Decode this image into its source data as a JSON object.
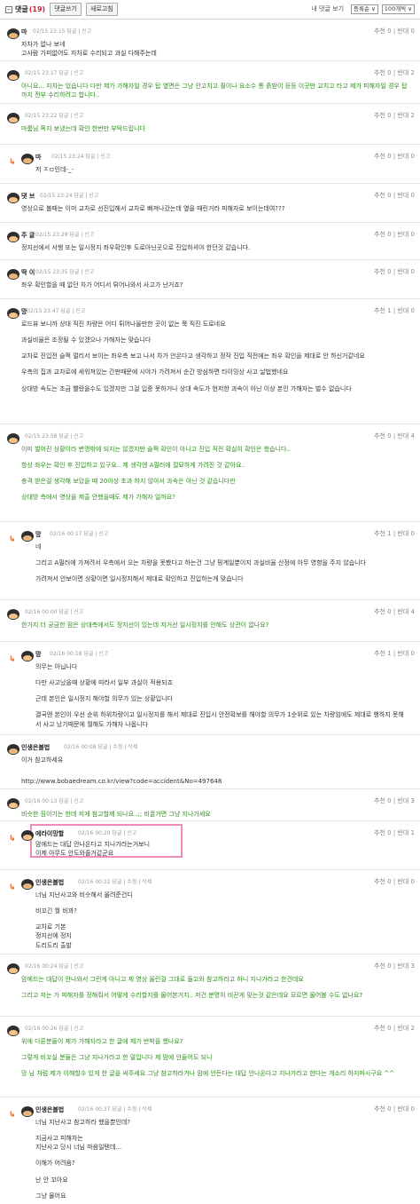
{
  "header": {
    "collapse_glyph": "−",
    "title": "댓글",
    "count": "(19)",
    "write_button": "댓글쓰기",
    "refresh_button": "새로고침",
    "my_comments": "내 댓글 보기",
    "sort_select": "등록순 ∨",
    "per_page_select": "100개씩 ∨"
  },
  "comments": [
    {
      "nick": "마",
      "meta": "02/15 23:15 답글 | 신고",
      "votes": "추천 0 | 반대 0",
      "color": "dark",
      "lines": [
        "자차가 없나 보네",
        "고사람 가피없어도 자차로 수리되고 과실 다해주는데"
      ]
    },
    {
      "nick": "",
      "meta": "02/15 23:17 답글 | 신고",
      "votes": "추천 0 | 반대 2",
      "color": "green",
      "lines": [
        "아니요... 자차는 있습니다 다만 제가 가해자일 경우 탑 옆면은 그냥 안고치고 휠이나 요소수 통 흙받이 등등 이곳만 교치고 타고 제가 피해자일 경우 탑까지 전부 수리하려고 합니다.."
      ]
    },
    {
      "nick": "",
      "meta": "02/15 23:22 답글 | 신고",
      "votes": "추천 0 | 반대 2",
      "color": "green",
      "lines": [
        "마룸님 쪽지 보냈는데 확인 한번만 부탁드립니다"
      ]
    },
    {
      "nick": "마",
      "meta": "02/15 23:24 답글 | 신고",
      "votes": "추천 0 | 반대 0",
      "color": "dark",
      "reply": true,
      "lines": [
        "저 ㅈㅁ인데-_-"
      ]
    },
    {
      "nick": "댓 브",
      "meta": "02/15 23:24 답글 | 신고",
      "votes": "추천 0 | 반대 0",
      "color": "dark",
      "lines": [
        "영상으로 볼때는 이미 교차로 선진입해서 교차로 빠져나갔는데 옆을 때린거라 피해자로 보이는데여???"
      ]
    },
    {
      "nick": "주     글",
      "meta": "02/15 23:29 답글 | 신고",
      "votes": "추천 0 | 반대 0",
      "color": "dark",
      "lines": [
        "정지선에서 서행 또는 일시정지 좌우확인후 도로아닌곳으로 진입하셔야 한던것 같습니다."
      ]
    },
    {
      "nick": "딱     이",
      "meta": "02/15 23:35 답글 | 신고",
      "votes": "추천 0 | 반대 0",
      "color": "dark",
      "lines": [
        "좌우 확인할을 때 없던 차가 어디서 튀어나와서 사고가 난거죠?"
      ]
    },
    {
      "nick": "망",
      "meta": "02/15 23:47 답글 | 신고",
      "votes": "추천 1 | 반대 0",
      "color": "dark",
      "lines": [
        "로드뷰 보니까 상대 직진 차량은 어디 튀어나올만한 곳이 없는 쭉 직진 도로네요",
        "과실비율은 조정될 수 있겠으나 가해자는 맞습니다",
        "교차로 진입전 슬쩍 멀리서 보이는 좌우측 보고 나서 차가 안온다고 생각하고 정작 진입 직전에는 좌우 확인을 제대로 안 하신거같네요",
        "우측의 집과 교차로에 세워져있는 간판때문에 시야가 가려져서 순간 방심하면 타이밍상 사고 날법했네요",
        "상대방 속도는 조금 빨랐을수도 있겠지만 그걸 입증 못하거나 상대 속도가 현저한 과속이 아닌 이상 본인 가해자는 벌수 없습니다"
      ]
    },
    {
      "nick": "",
      "meta": "02/15 23:58 답글 | 신고",
      "votes": "추천 0 | 반대 4",
      "color": "green",
      "lines": [
        "이미 벌어진 상황이라 변명밖에 되지는 않겠지만 슬쩍 확인이 아니고 진입 직전 확실히 확인은 했습니다..",
        "항상 좌우는 확인 후 진입하고 있구요.. 제 생각엔 A필러에 절묘하게 가려진 것 같아요..",
        "충격 받은걸 생각해 보았을 때 20이상 초과 하지 않아서 과속은 아닌 것 같습니다만",
        "상대방 측에서 영상을 제출 안했을때도 제가 가해자 일까요?"
      ]
    },
    {
      "nick": "망",
      "meta": "02/16 00:17 답글 | 신고",
      "votes": "추천 1 | 반대 0",
      "color": "dark",
      "reply": true,
      "lines": [
        "네",
        "그리고 A필러에 가져려서 우측에서 오는 차량을 못봤다고 하는건 그냥 핑계일뿐이지 과실비율 산정에 아무 영향을 주지 않습니다",
        "가려져서 안보이면 상황이면 일시정지해서 제대로 확인하고 진입하는게 맞습니다"
      ]
    },
    {
      "nick": "",
      "meta": "02/16 00:00 답글 | 신고",
      "votes": "추천 0 | 반대 4",
      "color": "green",
      "lines": [
        "한가지 더 궁금한 점은 상대측에서도 정지선이 있는데 저거선 일시정지를 안해도 상관이 없나요?"
      ]
    },
    {
      "nick": "망",
      "meta": "02/16 00:18 답글 | 신고",
      "votes": "추천 1 | 반대 0",
      "color": "dark",
      "reply": true,
      "lines": [
        "의무는 아닙니다",
        "다만 사고났을때 상황에 따라서 일부 과실이 적용되죠",
        "근데 본인은 일시정지 해야할 의무가 있는 상황입니다",
        "결국엔 본인이 우선 순위 하위차량이고 일시정지를 해서 제대로 진입시 안전확보를 해야할 의무가 1순위로 있는 차량임에도 제대로 행하지 못해서 사고 났기때문에 월해도 가해자 나옵니다"
      ]
    },
    {
      "nick": "인생은볼법",
      "meta": "02/16 00:08 답글 | 수정 | 삭제",
      "votes": "",
      "color": "dark",
      "lines": [
        "이거 참고하세유",
        "http://www.bobaedream.co.kr/view?code=accident&No=497648"
      ]
    },
    {
      "nick": "",
      "meta": "02/16 00:13 답글 | 신고",
      "votes": "추천 0 | 반대 3",
      "color": "green",
      "lines": [
        "비슷한 짐이기는 한데 저게 참고할께 되나요..;; 비끌거면 그냥 지나가세요"
      ]
    },
    {
      "nick": "에라이망할",
      "meta": "02/16 00:20 답글 | 신고",
      "votes": "추천 0 | 반대 1",
      "color": "dark",
      "reply": true,
      "highlight": true,
      "lines": [
        "맘에드는 대답 안나온다고 지나가라는거보니",
        "이제 아무도 안도와줄거같군요"
      ]
    },
    {
      "nick": "인생은볼법",
      "meta": "02/16 00:22 답글 | 수정 | 삭제",
      "votes": "추천 0 | 반대 0",
      "color": "dark",
      "reply": true,
      "lines": [
        "너님 지난사고와 비슷해서 올려준건디",
        "비꼬긴 뭘 비꽈?",
        "교차로 기본",
        "정지선에 정지",
        "도리도리 출발"
      ]
    },
    {
      "nick": "",
      "meta": "02/16 00:24 답글 | 신고",
      "votes": "추천 0 | 반대 3",
      "color": "green",
      "lines": [
        "맘에드는 대답이 안나와서 그런게 아니고 제 영상 올린걸 그대로 들고와 참고하라고 하니 지나가라고 한건데요",
        "그리고 저는 가 피해자를 정해줘서 어떻게 수리할지를 물어본거지.. 저건 분명히 비끈게 맞는것 같은데요 모르면 물어볼 수도 없나요?"
      ]
    },
    {
      "nick": "",
      "meta": "02/16 00:26 답글 | 신고",
      "votes": "추천 0 | 반대 2",
      "color": "green",
      "lines": [
        "위에 다른분들이 제가 가해자라고 한 글에 제가 반박을 했나요?",
        "그렇게 비꼬실 분들은 그냥 지나가라고 한 말입니다 제 맘에 안들어도 되니",
        "망   님 처럼 제가 이해할수 있게 한 글을 써주세요 그냥 참고하라거나 맘에 안든다는 대답 안나온다고 지나가라고 한다는 개소리 하지마시구요 ^^"
      ]
    },
    {
      "nick": "인생은볼법",
      "meta": "02/16 00:37 답글 | 수정 | 삭제",
      "votes": "추천 0 | 반대 0",
      "color": "dark",
      "reply": true,
      "lines": [
        "너님 지난사고 참고하라 했을뿐인데?",
        "지금사고 피해자는",
        "지난사고 당시 너님 마음일텐데...",
        "이해가 어려움?",
        "난 안 꼬아요",
        "그냥 물어요"
      ]
    }
  ]
}
